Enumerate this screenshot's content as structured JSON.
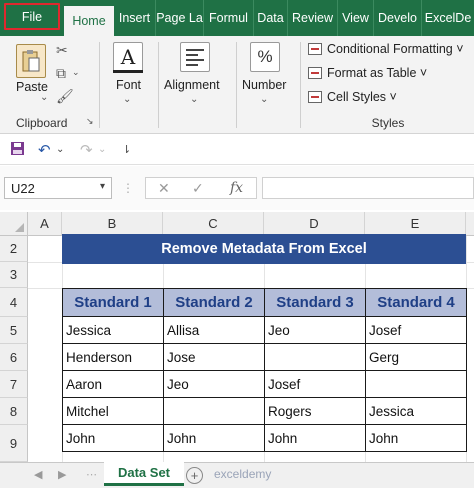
{
  "ribbon_tabs": [
    "File",
    "Home",
    "Insert",
    "Page La",
    "Formul",
    "Data",
    "Review",
    "View",
    "Develo",
    "ExcelDe"
  ],
  "groups": {
    "clipboard": {
      "paste": "Paste",
      "name": "Clipboard"
    },
    "font": {
      "label": "Font"
    },
    "alignment": {
      "label": "Alignment"
    },
    "number": {
      "label": "Number",
      "icon": "%"
    },
    "styles": {
      "conditional": "Conditional Formatting ˅",
      "format_table": "Format as Table ˅",
      "cell_styles": "Cell Styles ˅",
      "name": "Styles"
    }
  },
  "formula_bar": {
    "name_box": "U22",
    "fx": "fx",
    "value": ""
  },
  "columns": [
    "A",
    "B",
    "C",
    "D",
    "E"
  ],
  "rows": [
    "2",
    "3",
    "4",
    "5",
    "6",
    "7",
    "8",
    "9"
  ],
  "banner_title": "Remove Metadata From Excel",
  "table": {
    "headers": [
      "Standard 1",
      "Standard 2",
      "Standard 3",
      "Standard 4"
    ],
    "rows": [
      [
        "Jessica",
        "Allisa",
        "Jeo",
        "Josef"
      ],
      [
        "Henderson",
        "Jose",
        "",
        "Gerg"
      ],
      [
        "Aaron",
        "Jeo",
        "Josef",
        ""
      ],
      [
        "Mitchel",
        "",
        "Rogers",
        "Jessica"
      ],
      [
        "John",
        "John",
        "John",
        "John"
      ]
    ]
  },
  "sheet_tab": "Data Set",
  "watermark": "exceldemy",
  "colors": {
    "ribbon_green": "#1f7145",
    "banner_blue": "#2c4f93",
    "header_fill": "#b3bdd9",
    "file_outline": "#e0282e"
  }
}
